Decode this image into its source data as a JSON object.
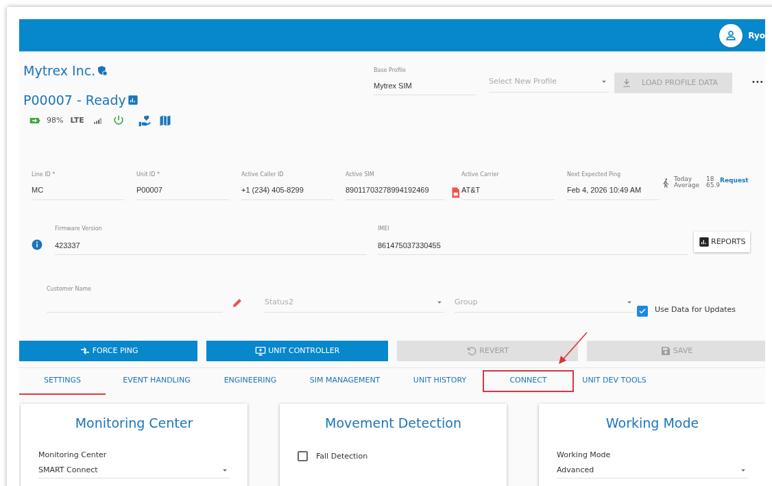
{
  "header": {
    "user_name": "Ryo"
  },
  "account": {
    "company": "Mytrex Inc.",
    "unit_title": "P00007 - Ready",
    "battery": "98%",
    "network": "LTE",
    "power_on": true
  },
  "profile": {
    "base_label": "Base Profile",
    "base_value": "Mytrex SIM",
    "select_placeholder": "Select New Profile",
    "load_button": "LOAD PROFILE DATA",
    "load_disabled": true,
    "more": "•••"
  },
  "fields": [
    {
      "label": "Line ID *",
      "value": "MC"
    },
    {
      "label": "Unit ID *",
      "value": "P00007"
    },
    {
      "label": "Active Caller ID",
      "value": "+1 (234) 405-8299"
    },
    {
      "label": "Active SIM",
      "value": "89011703278994192469",
      "kind": "sim"
    },
    {
      "label": "Active Carrier",
      "value": "AT&T"
    },
    {
      "label": "Next Expected Ping",
      "value": "Feb 4, 2026 10:49 AM"
    }
  ],
  "steps": {
    "today_label": "Today",
    "today_value": "18",
    "average_label": "Average",
    "average_value": "65.9",
    "request_link": "Request"
  },
  "firmware": {
    "label": "Firmware Version",
    "value": "423337"
  },
  "imei": {
    "label": "IMEI",
    "value": "861475037330455"
  },
  "reports_button": "REPORTS",
  "customer": {
    "label": "Customer Name",
    "status_placeholder": "Status2",
    "group_placeholder": "Group",
    "use_data_label": "Use Data for Updates",
    "use_data_checked": true
  },
  "actions": [
    {
      "label": "FORCE PING",
      "kind": "ping",
      "disabled": false
    },
    {
      "label": "UNIT CONTROLLER",
      "kind": "controller",
      "disabled": false
    },
    {
      "label": "REVERT",
      "kind": "revert",
      "disabled": true
    },
    {
      "label": "SAVE",
      "kind": "save",
      "disabled": true
    }
  ],
  "tabs": [
    {
      "label": "SETTINGS",
      "selected": true,
      "highlighted": false
    },
    {
      "label": "EVENT HANDLING",
      "selected": false,
      "highlighted": false
    },
    {
      "label": "ENGINEERING",
      "selected": false,
      "highlighted": false
    },
    {
      "label": "SIM MANAGEMENT",
      "selected": false,
      "highlighted": false
    },
    {
      "label": "UNIT HISTORY",
      "selected": false,
      "highlighted": false
    },
    {
      "label": "CONNECT",
      "selected": false,
      "highlighted": true
    },
    {
      "label": "UNIT DEV TOOLS",
      "selected": false,
      "highlighted": false
    }
  ],
  "cards": [
    {
      "title": "Monitoring Center",
      "kind": "select",
      "field_label": "Monitoring Center",
      "field_value": "SMART Connect"
    },
    {
      "title": "Movement Detection",
      "kind": "checkbox",
      "field_label": "Fall Detection",
      "checked": false
    },
    {
      "title": "Working Mode",
      "kind": "select",
      "field_label": "Working Mode",
      "field_value": "Advanced"
    }
  ]
}
